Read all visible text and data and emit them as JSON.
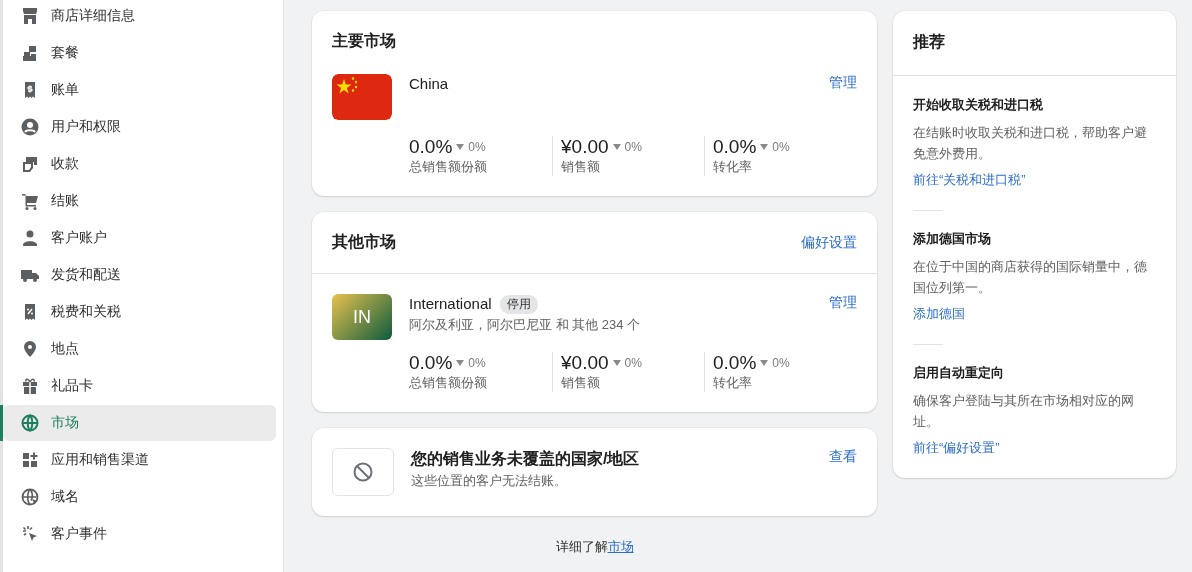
{
  "sidebar": {
    "items": [
      {
        "label": "商店详细信息",
        "selected": false
      },
      {
        "label": "套餐",
        "selected": false
      },
      {
        "label": "账单",
        "selected": false
      },
      {
        "label": "用户和权限",
        "selected": false
      },
      {
        "label": "收款",
        "selected": false
      },
      {
        "label": "结账",
        "selected": false
      },
      {
        "label": "客户账户",
        "selected": false
      },
      {
        "label": "发货和配送",
        "selected": false
      },
      {
        "label": "税费和关税",
        "selected": false
      },
      {
        "label": "地点",
        "selected": false
      },
      {
        "label": "礼品卡",
        "selected": false
      },
      {
        "label": "市场",
        "selected": true
      },
      {
        "label": "应用和销售渠道",
        "selected": false
      },
      {
        "label": "域名",
        "selected": false
      },
      {
        "label": "客户事件",
        "selected": false
      }
    ]
  },
  "primary_markets": {
    "title": "主要市场",
    "markets": [
      {
        "name": "China",
        "avatar": {
          "kind": "flag"
        },
        "action": "管理",
        "metrics": [
          {
            "value": "0.0%",
            "change": "0%",
            "label": "总销售额份额"
          },
          {
            "value": "¥0.00",
            "change": "0%",
            "label": "销售额"
          },
          {
            "value": "0.0%",
            "change": "0%",
            "label": "转化率"
          }
        ]
      }
    ]
  },
  "other_markets": {
    "title": "其他市场",
    "action": "偏好设置",
    "markets": [
      {
        "name": "International",
        "avatar": {
          "kind": "initials",
          "text": "IN"
        },
        "badge": "停用",
        "regions": "阿尔及利亚，阿尔巴尼亚 和 其他 234 个",
        "action": "管理",
        "metrics": [
          {
            "value": "0.0%",
            "change": "0%",
            "label": "总销售额份额"
          },
          {
            "value": "¥0.00",
            "change": "0%",
            "label": "销售额"
          },
          {
            "value": "0.0%",
            "change": "0%",
            "label": "转化率"
          }
        ]
      }
    ]
  },
  "uncovered": {
    "title": "您的销售业务未覆盖的国家/地区",
    "description": "这些位置的客户无法结账。",
    "action": "查看"
  },
  "footer": {
    "text": "详细了解",
    "link": "市场"
  },
  "recommendations": {
    "title": "推荐",
    "items": [
      {
        "title": "开始收取关税和进口税",
        "description": "在结账时收取关税和进口税，帮助客户避免意外费用。",
        "link": "前往“关税和进口税”"
      },
      {
        "title": "添加德国市场",
        "description": "在位于中国的商店获得的国际销量中，德国位列第一。",
        "link": "添加德国"
      },
      {
        "title": "启用自动重定向",
        "description": "确保客户登陆与其所在市场相对应的网址。",
        "link": "前往“偏好设置”"
      }
    ]
  }
}
